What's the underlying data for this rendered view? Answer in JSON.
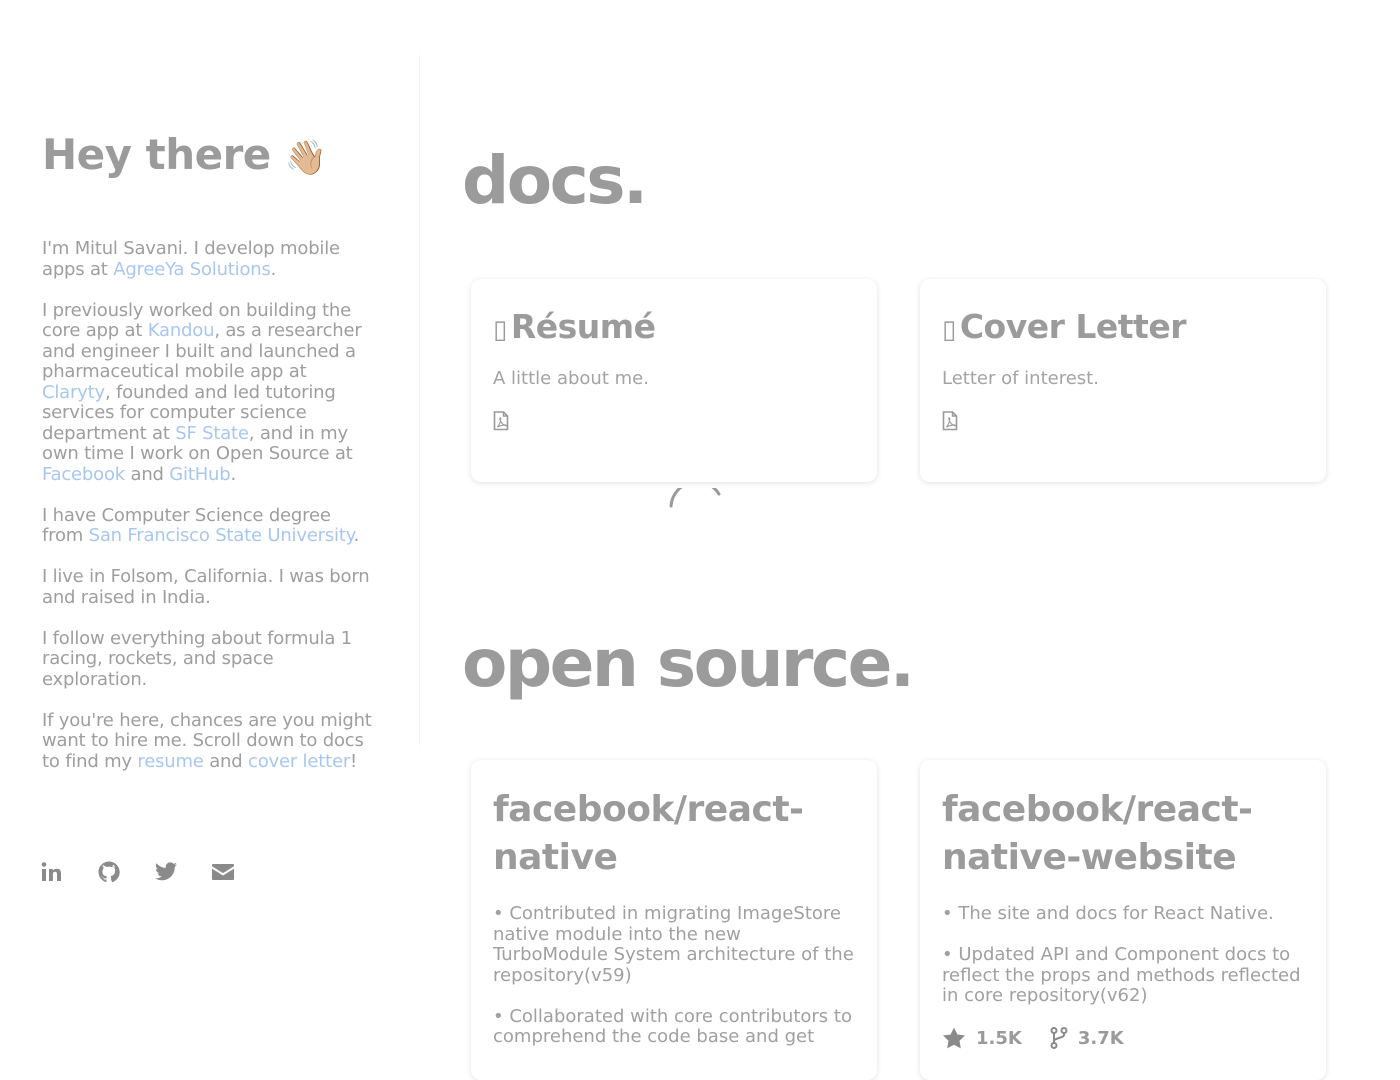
{
  "sidebar": {
    "title": "Hey there",
    "title_emoji": "👋🏼",
    "bio": [
      [
        {
          "text": "I'm Mitul Savani. I develop mobile apps at "
        },
        {
          "text": "AgreeYa Solutions",
          "link": true
        },
        {
          "text": "."
        }
      ],
      [
        {
          "text": "I previously worked on building the core app at "
        },
        {
          "text": "Kandou",
          "link": true
        },
        {
          "text": ", as a researcher and engineer I built and launched a pharmaceutical mobile app at "
        },
        {
          "text": "Claryty",
          "link": true
        },
        {
          "text": ", founded and led tutoring services for computer science department at "
        },
        {
          "text": "SF State",
          "link": true
        },
        {
          "text": ", and in my own time I work on Open Source at "
        },
        {
          "text": "Facebook",
          "link": true
        },
        {
          "text": " and "
        },
        {
          "text": "GitHub",
          "link": true
        },
        {
          "text": "."
        }
      ],
      [
        {
          "text": "I have Computer Science degree from "
        },
        {
          "text": "San Francisco State University",
          "link": true
        },
        {
          "text": "."
        }
      ],
      [
        {
          "text": "I live in Folsom, California. I was born and raised in India."
        }
      ],
      [
        {
          "text": "I follow everything about formula 1 racing, rockets, and space exploration."
        }
      ],
      [
        {
          "text": "If you're here, chances are you might want to hire me. Scroll down to docs to find my "
        },
        {
          "text": "resume",
          "link": true
        },
        {
          "text": " and "
        },
        {
          "text": "cover letter",
          "link": true
        },
        {
          "text": "!"
        }
      ]
    ],
    "socials": [
      {
        "name": "linkedin-icon"
      },
      {
        "name": "github-icon"
      },
      {
        "name": "twitter-icon"
      },
      {
        "name": "email-icon"
      }
    ]
  },
  "docs": {
    "title": "docs.",
    "cards": [
      {
        "glyph": "▯",
        "title": "Résumé",
        "desc": "A little about me.",
        "icon": "pdf-file-icon"
      },
      {
        "glyph": "▯",
        "title": "Cover Letter",
        "desc": "Letter of interest.",
        "icon": "pdf-file-icon"
      }
    ]
  },
  "open_source": {
    "title": "open source.",
    "repos": [
      {
        "name": "facebook/react-native",
        "bullets": [
          "• Contributed in migrating ImageStore native module into the new TurboModule System architecture of the repository(v59)",
          "• Collaborated with core contributors to comprehend the code base and get"
        ]
      },
      {
        "name": "facebook/react-native-website",
        "bullets": [
          "• The site and docs for React Native.",
          "• Updated API and Component docs to reflect the props and methods reflected in core repository(v62)"
        ],
        "stars": "1.5K",
        "forks": "3.7K"
      }
    ]
  },
  "colors": {
    "text": "#9b9b9b",
    "link": "#a8c7f0",
    "icon": "#8a8a8a"
  }
}
